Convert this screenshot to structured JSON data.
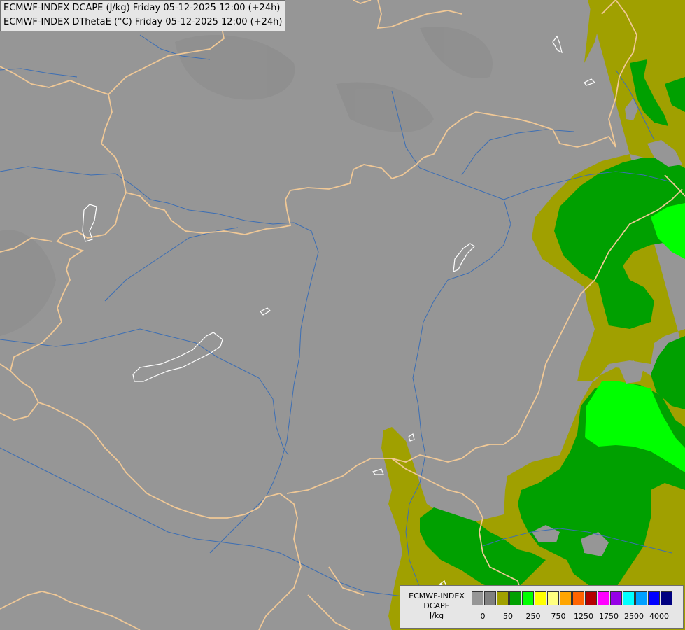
{
  "header": {
    "line1": "ECMWF-INDEX DCAPE (J/kg) Friday 05-12-2025 12:00 (+24h)",
    "line2": "ECMWF-INDEX DThetaE (°C) Friday 05-12-2025 12:00 (+24h)"
  },
  "colors": {
    "background": "#969696",
    "border": "#f0c896",
    "river": "#3c6eb4",
    "lake_outline": "#ffffff",
    "dcape_0_50": "#a0a000",
    "dcape_50_250": "#00a000",
    "dcape_250_500": "#00ff00"
  },
  "legend": {
    "title": [
      "ECMWF-INDEX",
      "DCAPE",
      "J/kg"
    ],
    "swatches": [
      "#969696",
      "#808080",
      "#a0a000",
      "#00a000",
      "#00ff00",
      "#ffff00",
      "#ffff80",
      "#ffa500",
      "#ff6400",
      "#b40000",
      "#ff00ff",
      "#9600e6",
      "#00ffff",
      "#00a0ff",
      "#0000ff",
      "#000080"
    ],
    "ticks": [
      "0",
      "50",
      "250",
      "750",
      "1250",
      "1750",
      "2500",
      "4000"
    ]
  }
}
